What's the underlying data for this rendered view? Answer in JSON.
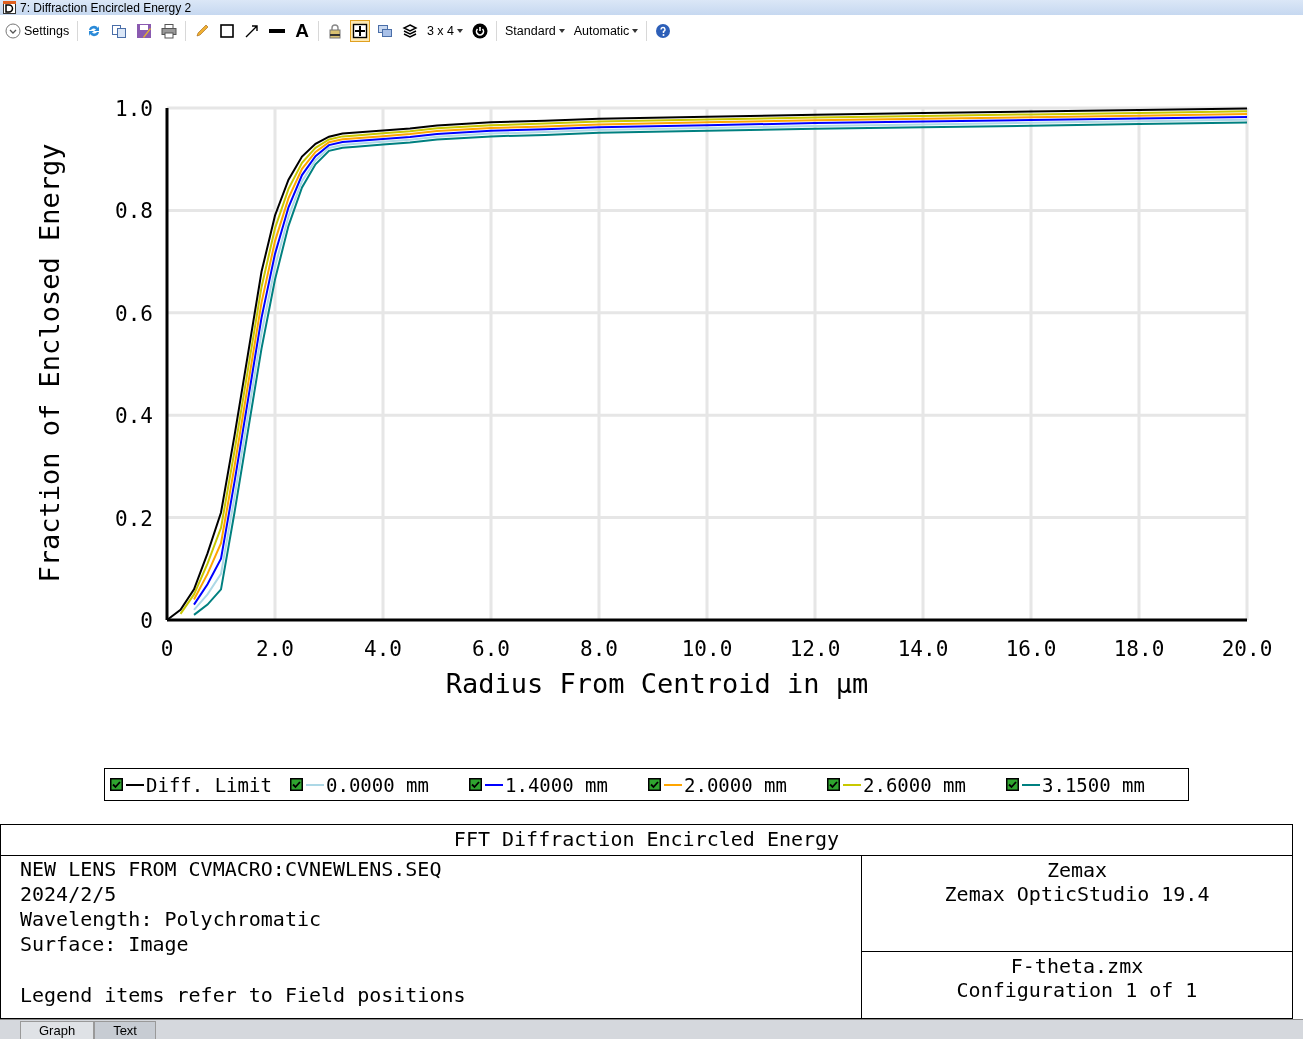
{
  "window": {
    "title": "7: Diffraction Encircled Energy 2"
  },
  "toolbar": {
    "settings": "Settings",
    "text_tool": "A",
    "layout_toggle": {
      "selected": true
    },
    "grid_dropdown": "3 x 4",
    "dropdowns": [
      "Standard",
      "Automatic"
    ]
  },
  "chart_data": {
    "type": "line",
    "grid": true,
    "xlabel": "Radius From Centroid in µm",
    "ylabel": "Fraction of Enclosed Energy",
    "xlim": [
      0,
      20
    ],
    "ylim": [
      0,
      1
    ],
    "xticks": [
      {
        "value": 0,
        "label": "0"
      },
      {
        "value": 2,
        "label": "2.0"
      },
      {
        "value": 4,
        "label": "4.0"
      },
      {
        "value": 6,
        "label": "6.0"
      },
      {
        "value": 8,
        "label": "8.0"
      },
      {
        "value": 10,
        "label": "10.0"
      },
      {
        "value": 12,
        "label": "12.0"
      },
      {
        "value": 14,
        "label": "14.0"
      },
      {
        "value": 16,
        "label": "16.0"
      },
      {
        "value": 18,
        "label": "18.0"
      },
      {
        "value": 20,
        "label": "20.0"
      }
    ],
    "yticks": [
      {
        "value": 0,
        "label": "0"
      },
      {
        "value": 0.2,
        "label": "0.2"
      },
      {
        "value": 0.4,
        "label": "0.4"
      },
      {
        "value": 0.6,
        "label": "0.6"
      },
      {
        "value": 0.8,
        "label": "0.8"
      },
      {
        "value": 1,
        "label": "1.0"
      }
    ],
    "x": [
      0,
      0.25,
      0.5,
      0.75,
      1,
      1.25,
      1.5,
      1.75,
      2,
      2.25,
      2.5,
      2.75,
      3,
      3.25,
      3.5,
      4,
      4.5,
      5,
      6,
      7,
      8,
      10,
      12,
      14,
      16,
      18,
      20
    ],
    "series": [
      {
        "name": "Diff. Limit",
        "color": "#000000",
        "values": [
          0,
          0.02,
          0.06,
          0.13,
          0.21,
          0.36,
          0.52,
          0.68,
          0.79,
          0.86,
          0.905,
          0.93,
          0.944,
          0.95,
          0.952,
          0.956,
          0.96,
          0.966,
          0.972,
          0.975,
          0.979,
          0.983,
          0.987,
          0.99,
          0.993,
          0.996,
          0.999
        ]
      },
      {
        "name": "0.0000 mm",
        "color": "#add8e6",
        "values": [
          null,
          null,
          0.02,
          0.05,
          0.09,
          0.24,
          0.4,
          0.56,
          0.69,
          0.788,
          0.857,
          0.898,
          0.922,
          0.928,
          0.93,
          0.934,
          0.938,
          0.944,
          0.95,
          0.953,
          0.957,
          0.961,
          0.965,
          0.968,
          0.971,
          0.974,
          0.977
        ]
      },
      {
        "name": "1.4000 mm",
        "color": "#0000ff",
        "values": [
          null,
          null,
          0.03,
          0.07,
          0.12,
          0.27,
          0.43,
          0.59,
          0.715,
          0.806,
          0.869,
          0.906,
          0.9275,
          0.9335,
          0.9355,
          0.9395,
          0.9435,
          0.9495,
          0.9555,
          0.9585,
          0.9625,
          0.9665,
          0.9705,
          0.9735,
          0.9765,
          0.9795,
          0.9825
        ]
      },
      {
        "name": "2.0000 mm",
        "color": "#ffa500",
        "values": [
          null,
          null,
          0.04,
          0.09,
          0.15,
          0.3,
          0.46,
          0.62,
          0.74,
          0.824,
          0.881,
          0.914,
          0.933,
          0.939,
          0.941,
          0.945,
          0.949,
          0.955,
          0.961,
          0.964,
          0.968,
          0.972,
          0.976,
          0.979,
          0.982,
          0.985,
          0.988
        ]
      },
      {
        "name": "2.6000 mm",
        "color": "#c8c800",
        "values": [
          null,
          0.012,
          0.05,
          0.11,
          0.18,
          0.33,
          0.49,
          0.65,
          0.765,
          0.842,
          0.893,
          0.922,
          0.9385,
          0.9445,
          0.9465,
          0.9505,
          0.9545,
          0.9605,
          0.9665,
          0.9695,
          0.9735,
          0.9775,
          0.9815,
          0.9845,
          0.9875,
          0.9905,
          0.9935
        ]
      },
      {
        "name": "3.1500 mm",
        "color": "#008080",
        "values": [
          null,
          null,
          0.01,
          0.03,
          0.06,
          0.21,
          0.37,
          0.53,
          0.665,
          0.77,
          0.845,
          0.89,
          0.9165,
          0.9225,
          0.9245,
          0.9285,
          0.9325,
          0.9385,
          0.9445,
          0.9475,
          0.9515,
          0.9555,
          0.9595,
          0.9625,
          0.9655,
          0.9685,
          0.9715
        ]
      }
    ]
  },
  "legend": [
    {
      "checked": true
    },
    {
      "checked": true
    },
    {
      "checked": true
    },
    {
      "checked": true
    },
    {
      "checked": true
    },
    {
      "checked": true
    }
  ],
  "info": {
    "title": "FFT Diffraction Encircled Energy",
    "left_lines": [
      "NEW LENS FROM CVMACRO:CVNEWLENS.SEQ",
      "2024/2/5",
      "Wavelength: Polychromatic",
      "Surface: Image"
    ],
    "left_note": "Legend items refer to Field positions",
    "right_top": [
      "Zemax",
      "Zemax OpticStudio 19.4"
    ],
    "right_bottom": [
      "F-theta.zmx",
      "Configuration 1 of 1"
    ]
  },
  "tabs": [
    {
      "label": "Graph",
      "selected": true
    },
    {
      "label": "Text",
      "selected": false
    }
  ]
}
